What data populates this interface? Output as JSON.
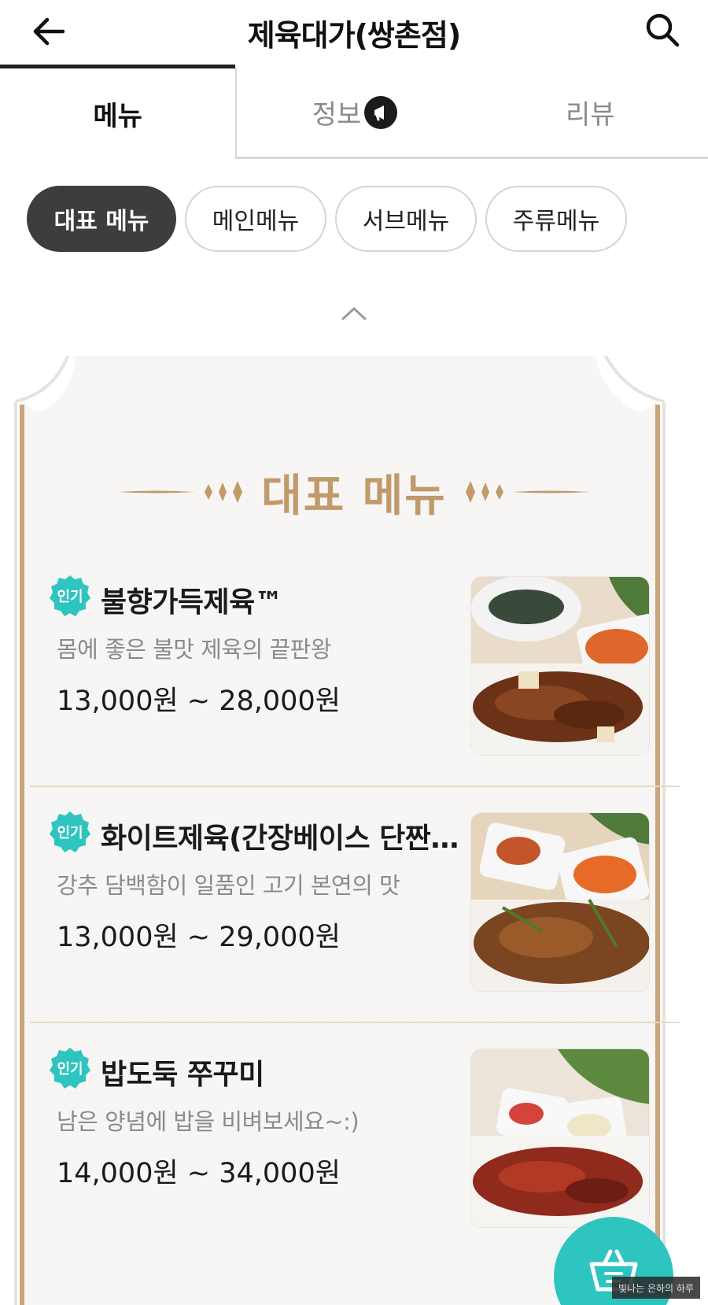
{
  "header": {
    "title": "제육대가(쌍촌점)",
    "back_icon": "arrow-left-icon",
    "search_icon": "search-icon"
  },
  "tabs": [
    {
      "label": "메뉴",
      "active": true
    },
    {
      "label": "정보",
      "active": false,
      "icon": "megaphone-icon"
    },
    {
      "label": "리뷰",
      "active": false
    }
  ],
  "chips": [
    {
      "label": "대표 메뉴",
      "active": true
    },
    {
      "label": "메인메뉴",
      "active": false
    },
    {
      "label": "서브메뉴",
      "active": false
    },
    {
      "label": "주류메뉴",
      "active": false
    }
  ],
  "section": {
    "title": "대표 메뉴"
  },
  "menu_items": [
    {
      "badge": "인기",
      "name": "불향가득제육™",
      "description": "몸에 좋은 불맛 제육의 끝판왕",
      "price": "13,000원 ~ 28,000원"
    },
    {
      "badge": "인기",
      "name": "화이트제육(간장베이스 단짠…",
      "description": "강추 담백함이 일품인 고기 본연의 맛",
      "price": "13,000원 ~ 29,000원"
    },
    {
      "badge": "인기",
      "name": "밥도둑 쭈꾸미",
      "description": "남은 양념에 밥을 비벼보세요~:)",
      "price": "14,000원 ~ 34,000원"
    }
  ],
  "cart": {
    "icon": "shopping-basket-icon"
  },
  "watermark": "빛나는 은하의 하루",
  "colors": {
    "accent_teal": "#2ec4bf",
    "gold": "#c09a6b",
    "chip_active": "#3d3d3d"
  }
}
